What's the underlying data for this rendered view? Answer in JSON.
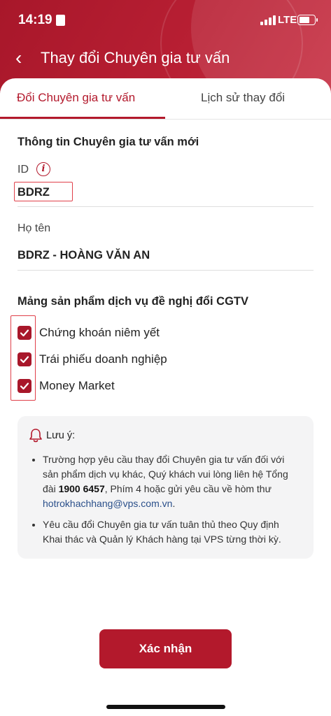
{
  "status_bar": {
    "time": "14:19",
    "network": "LTE"
  },
  "header": {
    "title": "Thay đổi Chuyên gia tư vấn"
  },
  "tabs": [
    {
      "label": "Đổi Chuyên gia tư vấn",
      "active": true
    },
    {
      "label": "Lịch sử thay đổi",
      "active": false
    }
  ],
  "form": {
    "section_title": "Thông tin Chuyên gia tư vấn mới",
    "id_label": "ID",
    "id_value": "BDRZ",
    "name_label": "Họ tên",
    "name_value": "BDRZ - HOÀNG VĂN AN"
  },
  "products": {
    "section_title": "Mảng sản phẩm dịch vụ đề nghị đổi CGTV",
    "items": [
      {
        "label": "Chứng khoán niêm yết",
        "checked": true
      },
      {
        "label": "Trái phiếu doanh nghiệp",
        "checked": true
      },
      {
        "label": "Money Market",
        "checked": true
      }
    ]
  },
  "note": {
    "title": "Lưu ý:",
    "b1_part1": "Trường hợp yêu cầu thay đổi Chuyên gia tư vấn đối với sản phẩm dịch vụ khác, Quý khách vui lòng liên hệ Tổng đài ",
    "b1_hotline": "1900 6457",
    "b1_part2": ", Phím 4 hoặc gửi yêu cầu về hòm thư ",
    "b1_email": "hotrokhachhang@vps.com.vn",
    "b1_end": ".",
    "b2": "Yêu cầu đổi Chuyên gia tư vấn tuân thủ theo Quy định Khai thác và Quản lý Khách hàng tại VPS từng thời kỳ."
  },
  "confirm_button": "Xác nhận",
  "colors": {
    "brand": "#b3192c",
    "link": "#2a4f8a",
    "note_bg": "#f4f4f5"
  }
}
